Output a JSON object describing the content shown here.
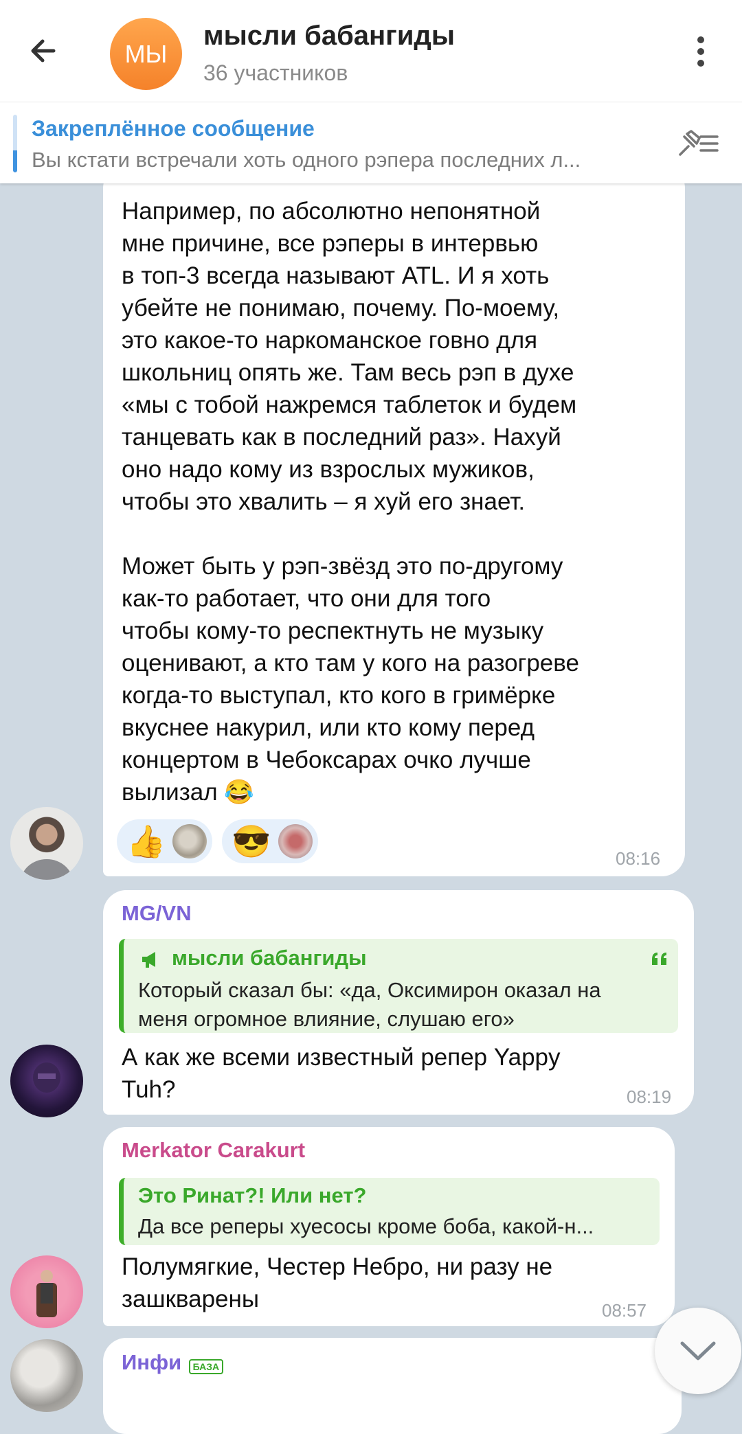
{
  "header": {
    "avatar_text": "МЫ",
    "title": "мысли бабангиды",
    "subtitle": "36 участников"
  },
  "pinned": {
    "title": "Закреплённое сообщение",
    "text": "Вы кстати встречали хоть одного рэпера последних л..."
  },
  "messages": [
    {
      "text": "Например, по абсолютно непонятной\nмне причине, все рэперы в интервью\nв топ-3 всегда называют ATL. И я хоть\nубейте не понимаю, почему. По-моему,\nэто какое-то наркоманское говно для\nшкольниц опять же. Там весь рэп в духе\n«мы с тобой нажремся таблеток и будем\nтанцевать как в последний раз». Нахуй\nоно надо кому из взрослых мужиков,\nчтобы это хвалить – я хуй его знает.\n\nМожет быть у рэп-звёзд это по-другому\nкак-то работает, что они для того\nчтобы кому-то респектнуть не музыку\nоценивают, а кто там у кого на разогреве\nкогда-то выступал, кто кого в гримёрке\nвкуснее накурил, или кто кому перед\nконцертом в Чебоксарах очко лучше\nвылизал 😂",
      "reactions": [
        {
          "emoji": "👍"
        },
        {
          "emoji": "😎"
        }
      ],
      "time": "08:16"
    },
    {
      "sender": "MG/VN",
      "sender_color": "#7b63d6",
      "quote_title": "мысли бабангиды",
      "quote_text": "Который сказал бы: «да, Оксимирон оказал на\nменя огромное влияние, слушаю его»",
      "text": "А как же всеми известный репер Yappy\nTuh?",
      "time": "08:19"
    },
    {
      "sender": "Merkator Carakurt",
      "sender_color": "#c94b8b",
      "quote_title": "Это Ринат?! Или нет?",
      "quote_text": "Да все реперы хуесосы кроме боба, какой-н...",
      "text": "Полумягкие, Честер Небро, ни разу не\nзашкварены",
      "time": "08:57"
    },
    {
      "sender": "Инфи",
      "sender_color": "#7b63d6",
      "badge": "БАЗА"
    }
  ]
}
